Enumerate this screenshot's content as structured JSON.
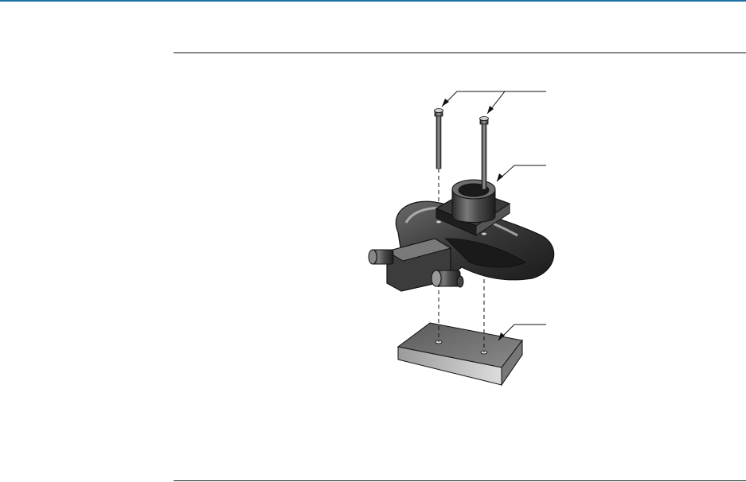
{
  "colors": {
    "accent": "#1f6fa6",
    "rule": "#111111",
    "part_dark": "#2e2e2e",
    "part_mid": "#5a5a5a",
    "part_light": "#9a9a9a"
  },
  "figure": {
    "parts": [
      "bolt-left",
      "bolt-right",
      "mounting-flange",
      "sensor-body",
      "base-plate"
    ],
    "leaders": [
      "bolts-leader",
      "flange-leader",
      "plate-leader"
    ]
  }
}
